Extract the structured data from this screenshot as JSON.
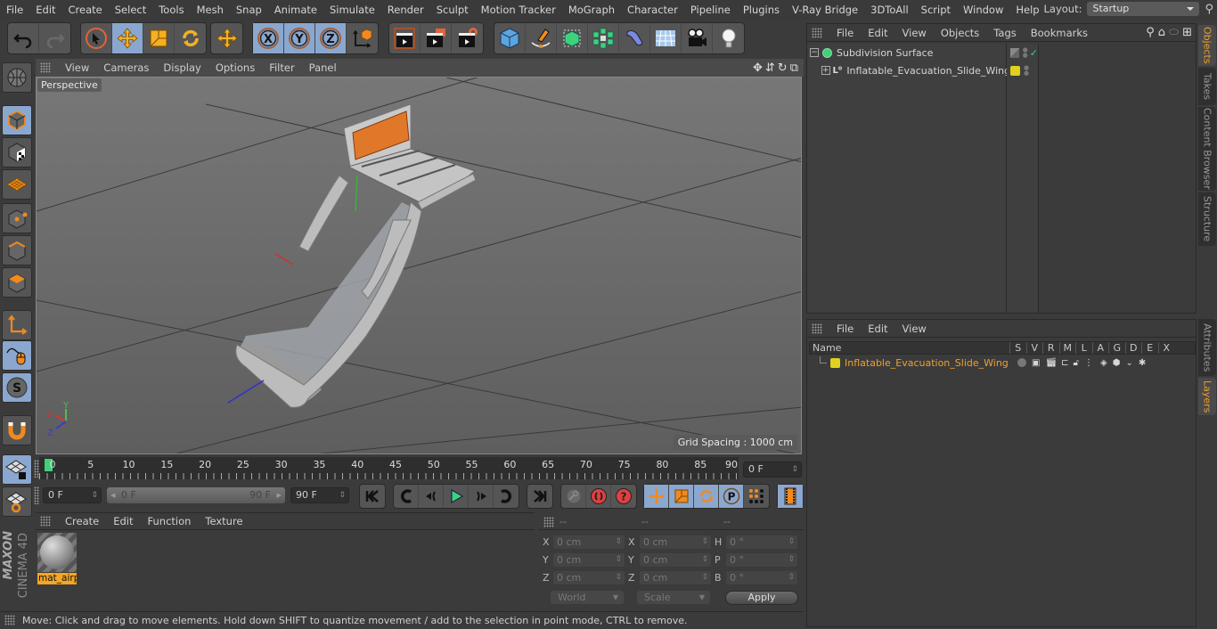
{
  "menubar": {
    "items": [
      "File",
      "Edit",
      "Create",
      "Select",
      "Tools",
      "Mesh",
      "Snap",
      "Animate",
      "Simulate",
      "Render",
      "Sculpt",
      "Motion Tracker",
      "MoGraph",
      "Character",
      "Pipeline",
      "Plugins",
      "V-Ray Bridge",
      "3DToAll",
      "Script",
      "Window",
      "Help"
    ],
    "layout_label": "Layout:",
    "layout_value": "Startup"
  },
  "toolbar": {
    "groups": [
      [
        "undo-icon",
        "redo-icon"
      ],
      [
        "live-selection-icon",
        "move-icon",
        "scale-icon",
        "rotate-icon"
      ],
      [
        "recent-tool-move-icon"
      ],
      [
        "x-axis-lock-icon",
        "y-axis-lock-icon",
        "z-axis-lock-icon",
        "world-coordinate-system-icon"
      ],
      [
        "render-view-icon",
        "render-to-picture-viewer-icon",
        "render-settings-icon"
      ],
      [
        "cube-icon",
        "pen-spline-icon",
        "subdivision-surface-icon",
        "cloner-icon",
        "bend-deformer-icon",
        "floor-icon",
        "camera-icon",
        "light-icon"
      ]
    ]
  },
  "left_toolbar": {
    "items": [
      "make-editable-icon",
      "model-mode-icon",
      "texture-mode-icon",
      "workplane-icon",
      "point-mode-icon",
      "edge-mode-icon",
      "polygon-mode-icon",
      "axis-mode-icon",
      "tweak-mode-icon",
      "snap-icon",
      "magnet-icon",
      "workplane-lock-icon",
      "locked-workplane-icon"
    ]
  },
  "viewport": {
    "menu": [
      "View",
      "Cameras",
      "Display",
      "Options",
      "Filter",
      "Panel"
    ],
    "camera_label": "Perspective",
    "grid_spacing": "Grid Spacing : 1000 cm",
    "axis_labels": {
      "x": "X",
      "y": "Y",
      "z": "Z"
    }
  },
  "timeline": {
    "ticks": [
      "0",
      "5",
      "10",
      "15",
      "20",
      "25",
      "30",
      "35",
      "40",
      "45",
      "50",
      "55",
      "60",
      "65",
      "70",
      "75",
      "80",
      "85",
      "90"
    ],
    "current_frame": "0 F",
    "start_frame": "0 F",
    "range_start": "0 F",
    "range_end": "90 F",
    "end_frame": "90 F"
  },
  "materials": {
    "menu": [
      "Create",
      "Edit",
      "Function",
      "Texture"
    ],
    "items": [
      {
        "name": "mat_airp"
      }
    ]
  },
  "brand": {
    "maxon": "MAXON",
    "product": "CINEMA 4D"
  },
  "coordinates": {
    "headers": [
      "--",
      "--",
      "--"
    ],
    "position": {
      "x": "0 cm",
      "y": "0 cm",
      "z": "0 cm"
    },
    "size": {
      "x": "0 cm",
      "y": "0 cm",
      "z": "0 cm"
    },
    "rotation": {
      "h": "0 °",
      "p": "0 °",
      "b": "0 °"
    },
    "labels": {
      "x": "X",
      "y": "Y",
      "z": "Z",
      "h": "H",
      "p": "P",
      "b": "B"
    },
    "space_dropdown": "World",
    "mode_dropdown": "Scale",
    "apply_label": "Apply"
  },
  "status_bar": {
    "text": "Move: Click and drag to move elements. Hold down SHIFT to quantize movement / add to the selection in point mode, CTRL to remove."
  },
  "object_manager": {
    "menu": [
      "File",
      "Edit",
      "View",
      "Objects",
      "Tags",
      "Bookmarks"
    ],
    "objects": [
      {
        "name": "Subdivision Surface",
        "tag_color": "#7a7a7a"
      },
      {
        "name": "Inflatable_Evacuation_Slide_Wing",
        "tag_color": "#e0d020"
      }
    ]
  },
  "layer_manager": {
    "menu": [
      "File",
      "Edit",
      "View"
    ],
    "columns": [
      "Name",
      "S",
      "V",
      "R",
      "M",
      "L",
      "A",
      "G",
      "D",
      "E",
      "X"
    ],
    "layers": [
      {
        "name": "Inflatable_Evacuation_Slide_Wing",
        "color": "#e0d020"
      }
    ]
  },
  "side_tabs": {
    "top": [
      "Objects",
      "Takes",
      "Content Browser",
      "Structure"
    ],
    "bottom": [
      "Attributes",
      "Layers"
    ]
  },
  "colors": {
    "accent": "#f0a030",
    "selection": "#8aa7cf",
    "play": "#3fd27a"
  }
}
